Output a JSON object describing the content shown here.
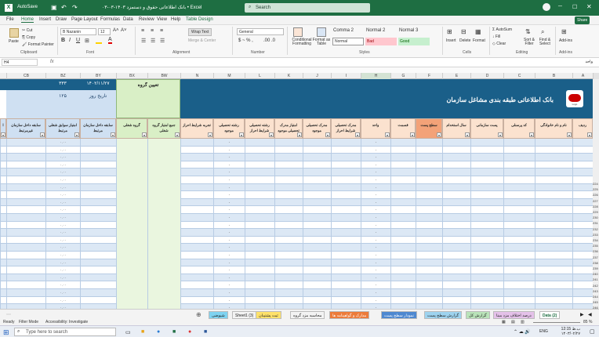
{
  "window": {
    "title": "بانک اطلاعاتی حقوق و دستمزد ۱۴۰۳-۰۳-۰۳ • Excel",
    "search_placeholder": "Search"
  },
  "menu": {
    "tabs": [
      "File",
      "Home",
      "Insert",
      "Draw",
      "Page Layout",
      "Formulas",
      "Data",
      "Review",
      "View",
      "Help",
      "Table Design"
    ],
    "share": "Share"
  },
  "ribbon": {
    "paste": "Paste",
    "cut": "Cut",
    "copy": "Copy",
    "format_painter": "Format Painter",
    "font_name": "B Nazanin",
    "font_size": "12",
    "wrap_text": "Wrap Text",
    "merge_center": "Merge & Center",
    "number_format": "General",
    "conditional_formatting": "Conditional Formatting",
    "format_as_table": "Format as Table",
    "styles": [
      "Comma 2",
      "Normal 2",
      "Normal 3",
      "Normal",
      "Bad",
      "Good"
    ],
    "insert": "Insert",
    "delete": "Delete",
    "format": "Format",
    "autosum": "AutoSum",
    "fill": "Fill",
    "clear": "Clear",
    "sort_filter": "Sort & Filter",
    "find_select": "Find & Select",
    "addins": "Add-ins",
    "groups": [
      "Clipboard",
      "Font",
      "Alignment",
      "Number",
      "Styles",
      "Cells",
      "Editing",
      "Add-ins"
    ]
  },
  "formula_bar": {
    "name_box": "H4",
    "fx": "fx",
    "content": "واحد"
  },
  "columns": [
    "CB",
    "BZ",
    "BY",
    "BX",
    "BW",
    "N",
    "M",
    "L",
    "K",
    "J",
    "I",
    "H",
    "G",
    "F",
    "E",
    "D",
    "C",
    "B",
    "A"
  ],
  "header_band": {
    "title": "بانک اطلاعاتی طبقه بندی مشاغل سازمان",
    "logo": "Logo",
    "date": "۱۴۰۲/۱۱/۲۷",
    "date_label": "تاریخ روز",
    "count1": "۳۳۳",
    "count2": "۱۲۵",
    "group_label": "تعیین گروه"
  },
  "table_headers": [
    "ردیف",
    "نام و نام خانوادگی",
    "کد پرسنلی",
    "پست سازمانی",
    "سال استخدام",
    "سطح پست",
    "قسمت",
    "واحد",
    "مدرک تحصیلی شرایط احراز",
    "مدرک تحصیلی موجود",
    "امتیاز مدرک تحصیلی موجود",
    "رشته تحصیلی شرایط احراز",
    "رشته تحصیلی موجود",
    "تجربه شرایط احراز",
    "جمع امتیاز گروه شغلی",
    "گروه شغلی",
    "سابقه داخل سازمان مرتبط",
    "امتیاز سوابق شغلی مرتبط",
    "سابقه داخل سازمان غیرمرتبط",
    "ا"
  ],
  "row_numbers": [
    "224",
    "225",
    "226",
    "227",
    "228",
    "229",
    "230",
    "231",
    "232",
    "233",
    "234",
    "235",
    "236",
    "237",
    "238",
    "239",
    "240",
    "241",
    "242",
    "243",
    "244",
    "245",
    "246"
  ],
  "zero_value": "۰.۰۰",
  "dash_value": "-",
  "sheet_tabs": [
    "Data (2)",
    "درصد اختلاف مزد مبنا",
    "گزارش کل",
    "گزارش سطح پست",
    "نمودار سطح پست",
    "مدارک و گواهینامه ها",
    "محاسبه مزد گروه",
    "ثبت پشتیبان",
    "Sheet1 (3)",
    "شیوضی"
  ],
  "status": {
    "ready": "Ready",
    "filter": "Filter Mode",
    "accessibility": "Accessibility: Investigate",
    "zoom": "85 %"
  },
  "taskbar": {
    "search": "Type here to search",
    "time": "12:15 ب.ظ",
    "date": "۱۴۰۳/۰۲/۲۷",
    "lang": "ENG"
  },
  "colors": {
    "excel_green": "#1e6e42",
    "header_blue": "#1a5f89",
    "green_band": "#2f8a3c",
    "light_green": "#d9efc6",
    "orange_header": "#f6c6a6",
    "peach_header": "#fbe2cf",
    "row_blue": "#dce8f5"
  }
}
